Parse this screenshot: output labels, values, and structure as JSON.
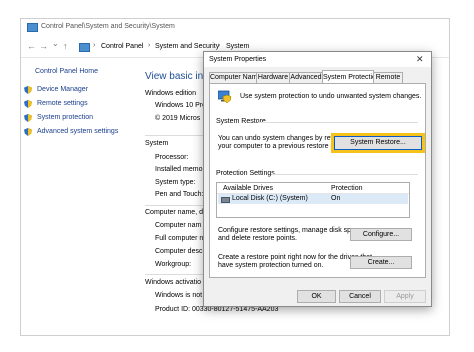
{
  "window": {
    "title": "Control Panel\\System and Security\\System",
    "nav_back": "←",
    "nav_forward": "→",
    "nav_dropdown": "⌄",
    "nav_up": "↑",
    "breadcrumb": [
      "Control Panel",
      "System and Security",
      "System"
    ],
    "breadcrumb_sep": "›"
  },
  "sidebar": {
    "home": "Control Panel Home",
    "items": [
      {
        "label": "Device Manager",
        "icon": "shield-icon"
      },
      {
        "label": "Remote settings",
        "icon": "shield-icon"
      },
      {
        "label": "System protection",
        "icon": "shield-icon"
      },
      {
        "label": "Advanced system settings",
        "icon": "shield-icon"
      }
    ]
  },
  "main": {
    "heading": "View basic info",
    "windows_edition": {
      "label": "Windows edition",
      "rows": [
        "Windows 10 Pro",
        "© 2019 Micros"
      ]
    },
    "system": {
      "label": "System",
      "rows": [
        "Processor:",
        "Installed memo",
        "System type:",
        "Pen and Touch:"
      ]
    },
    "computer_name": {
      "label": "Computer name, d",
      "rows": [
        "Computer nam",
        "Full computer n",
        "Computer descr",
        "Workgroup:"
      ]
    },
    "activation": {
      "label": "Windows activatio",
      "rows": [
        "Windows is not"
      ],
      "product_id": "Product ID: 00330-80127-51475-AA203"
    }
  },
  "dialog": {
    "title": "System Properties",
    "close": "✕",
    "tabs": [
      "Computer Name",
      "Hardware",
      "Advanced",
      "System Protection",
      "Remote"
    ],
    "active_tab": "System Protection",
    "intro": "Use system protection to undo unwanted system changes.",
    "restore_group": "System Restore",
    "restore_text_1": "You can undo system changes by reverting",
    "restore_text_2": "your computer to a previous restore point.",
    "restore_button": "System Restore...",
    "protection_group": "Protection Settings",
    "drives_columns": [
      "Available Drives",
      "Protection"
    ],
    "drives": [
      {
        "name": "Local Disk (C:) (System)",
        "protection": "On"
      }
    ],
    "configure_text_1": "Configure restore settings, manage disk space,",
    "configure_text_2": "and delete restore points.",
    "configure_button": "Configure...",
    "create_text_1": "Create a restore point right now for the drives that",
    "create_text_2": "have system protection turned on.",
    "create_button": "Create...",
    "ok": "OK",
    "cancel": "Cancel",
    "apply": "Apply",
    "colors": {
      "highlight": "#f6c21c",
      "link": "#1a3e8c"
    }
  }
}
